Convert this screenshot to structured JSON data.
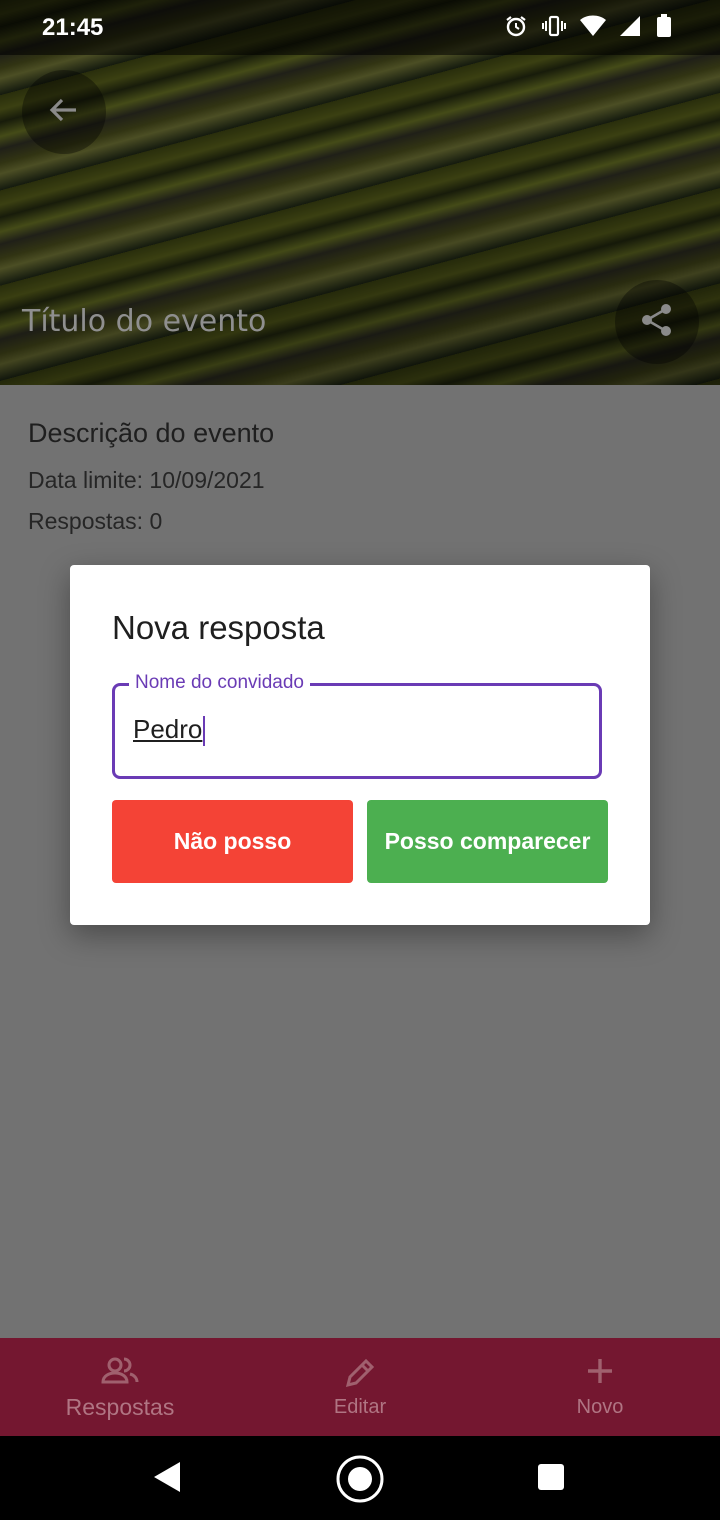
{
  "status_bar": {
    "time": "21:45"
  },
  "header": {
    "title": "Título do evento"
  },
  "event": {
    "description": "Descrição do evento",
    "deadline": "Data limite: 10/09/2021",
    "responses": "Respostas: 0"
  },
  "dialog": {
    "title": "Nova resposta",
    "field_label": "Nome do convidado",
    "field_value": "Pedro",
    "decline_label": "Não posso",
    "accept_label": "Posso comparecer"
  },
  "bottom_nav": {
    "items": [
      {
        "label": "Respostas",
        "icon": "people-icon"
      },
      {
        "label": "Editar",
        "icon": "pencil-icon"
      },
      {
        "label": "Novo",
        "icon": "plus-icon"
      }
    ]
  },
  "colors": {
    "accent": "#6a3bb5",
    "decline": "#f44336",
    "accept": "#4caf50",
    "bottom_nav_bg": "#741730"
  }
}
